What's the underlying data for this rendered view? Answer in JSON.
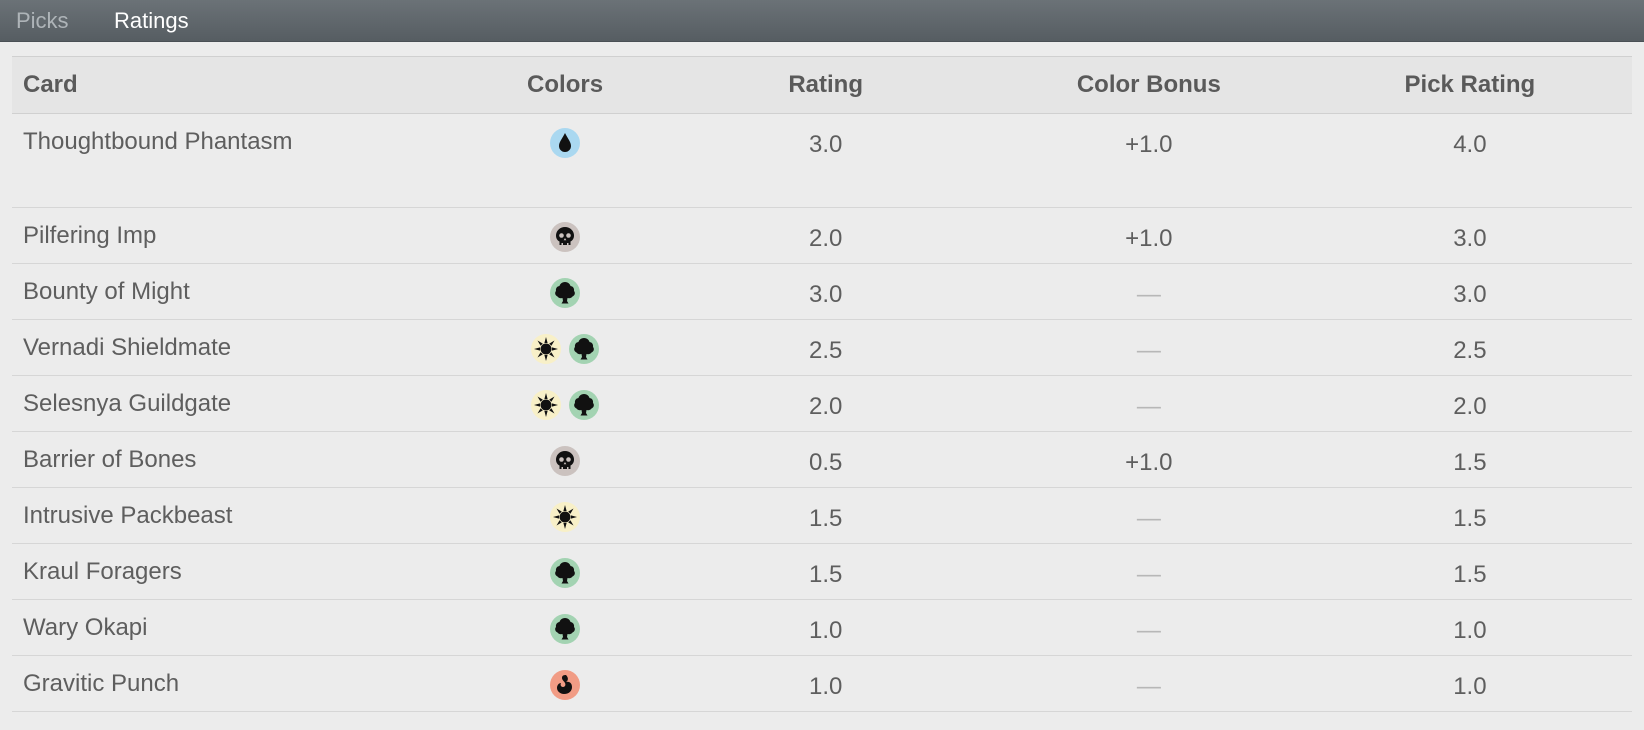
{
  "tabs": [
    {
      "label": "Picks",
      "active": false
    },
    {
      "label": "Ratings",
      "active": true
    }
  ],
  "table": {
    "headers": {
      "card": "Card",
      "colors": "Colors",
      "rating": "Rating",
      "bonus": "Color Bonus",
      "pick": "Pick Rating"
    },
    "rows": [
      {
        "card": "Thoughtbound Phantasm",
        "colors": [
          "blue"
        ],
        "rating": "3.0",
        "bonus": "+1.0",
        "pick": "4.0"
      },
      {
        "card": "Pilfering Imp",
        "colors": [
          "black"
        ],
        "rating": "2.0",
        "bonus": "+1.0",
        "pick": "3.0"
      },
      {
        "card": "Bounty of Might",
        "colors": [
          "green"
        ],
        "rating": "3.0",
        "bonus": "—",
        "pick": "3.0"
      },
      {
        "card": "Vernadi Shieldmate",
        "colors": [
          "white",
          "green"
        ],
        "rating": "2.5",
        "bonus": "—",
        "pick": "2.5"
      },
      {
        "card": "Selesnya Guildgate",
        "colors": [
          "white",
          "green"
        ],
        "rating": "2.0",
        "bonus": "—",
        "pick": "2.0"
      },
      {
        "card": "Barrier of Bones",
        "colors": [
          "black"
        ],
        "rating": "0.5",
        "bonus": "+1.0",
        "pick": "1.5"
      },
      {
        "card": "Intrusive Packbeast",
        "colors": [
          "white"
        ],
        "rating": "1.5",
        "bonus": "—",
        "pick": "1.5"
      },
      {
        "card": "Kraul Foragers",
        "colors": [
          "green"
        ],
        "rating": "1.5",
        "bonus": "—",
        "pick": "1.5"
      },
      {
        "card": "Wary Okapi",
        "colors": [
          "green"
        ],
        "rating": "1.0",
        "bonus": "—",
        "pick": "1.0"
      },
      {
        "card": "Gravitic Punch",
        "colors": [
          "red"
        ],
        "rating": "1.0",
        "bonus": "—",
        "pick": "1.0"
      }
    ]
  },
  "mana_colors": {
    "blue": "#aad8f0",
    "black": "#cbc2bf",
    "green": "#a3d3b2",
    "white": "#f8f0c8",
    "red": "#f19c85"
  }
}
